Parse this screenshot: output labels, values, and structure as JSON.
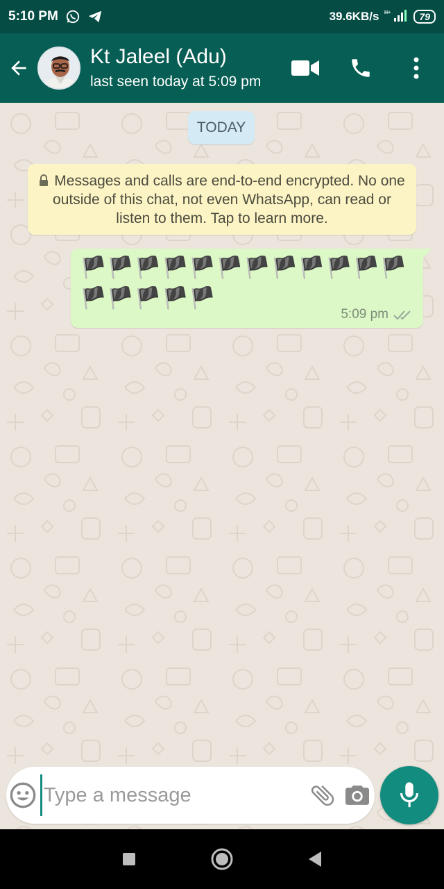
{
  "status_bar": {
    "time": "5:10 PM",
    "network_speed": "39.6KB/s",
    "battery": "79",
    "icons": [
      "whatsapp-notification-icon",
      "telegram-notification-icon",
      "signal-icon",
      "battery-icon"
    ]
  },
  "header": {
    "contact_name": "Kt Jaleel (Adu)",
    "last_seen": "last seen today at 5:09 pm",
    "icons": [
      "back-arrow-icon",
      "video-call-icon",
      "voice-call-icon",
      "more-options-icon"
    ]
  },
  "chat": {
    "date_chip": "TODAY",
    "encryption_notice": "Messages and calls are end-to-end encrypted. No one outside of this chat, not even WhatsApp, can read or listen to them. Tap to learn more.",
    "messages": [
      {
        "direction": "outgoing",
        "text": "🏴🏴🏴🏴🏴🏴🏴🏴🏴🏴🏴🏴🏴🏴🏴🏴🏴",
        "time": "5:09 pm",
        "status": "delivered"
      }
    ]
  },
  "composer": {
    "placeholder": "Type a message",
    "value": "",
    "icons": [
      "emoji-icon",
      "attach-icon",
      "camera-icon",
      "mic-icon"
    ]
  },
  "nav": {
    "icons": [
      "recents-icon",
      "home-icon",
      "back-icon"
    ]
  },
  "colors": {
    "header_bg": "#075e54",
    "status_bg": "#054d44",
    "outgoing_bubble": "#dcf8c6",
    "notice_bubble": "#fdf4c5",
    "date_chip": "#d4eaf4",
    "accent": "#128c7e",
    "chat_bg": "#ece5dd"
  }
}
